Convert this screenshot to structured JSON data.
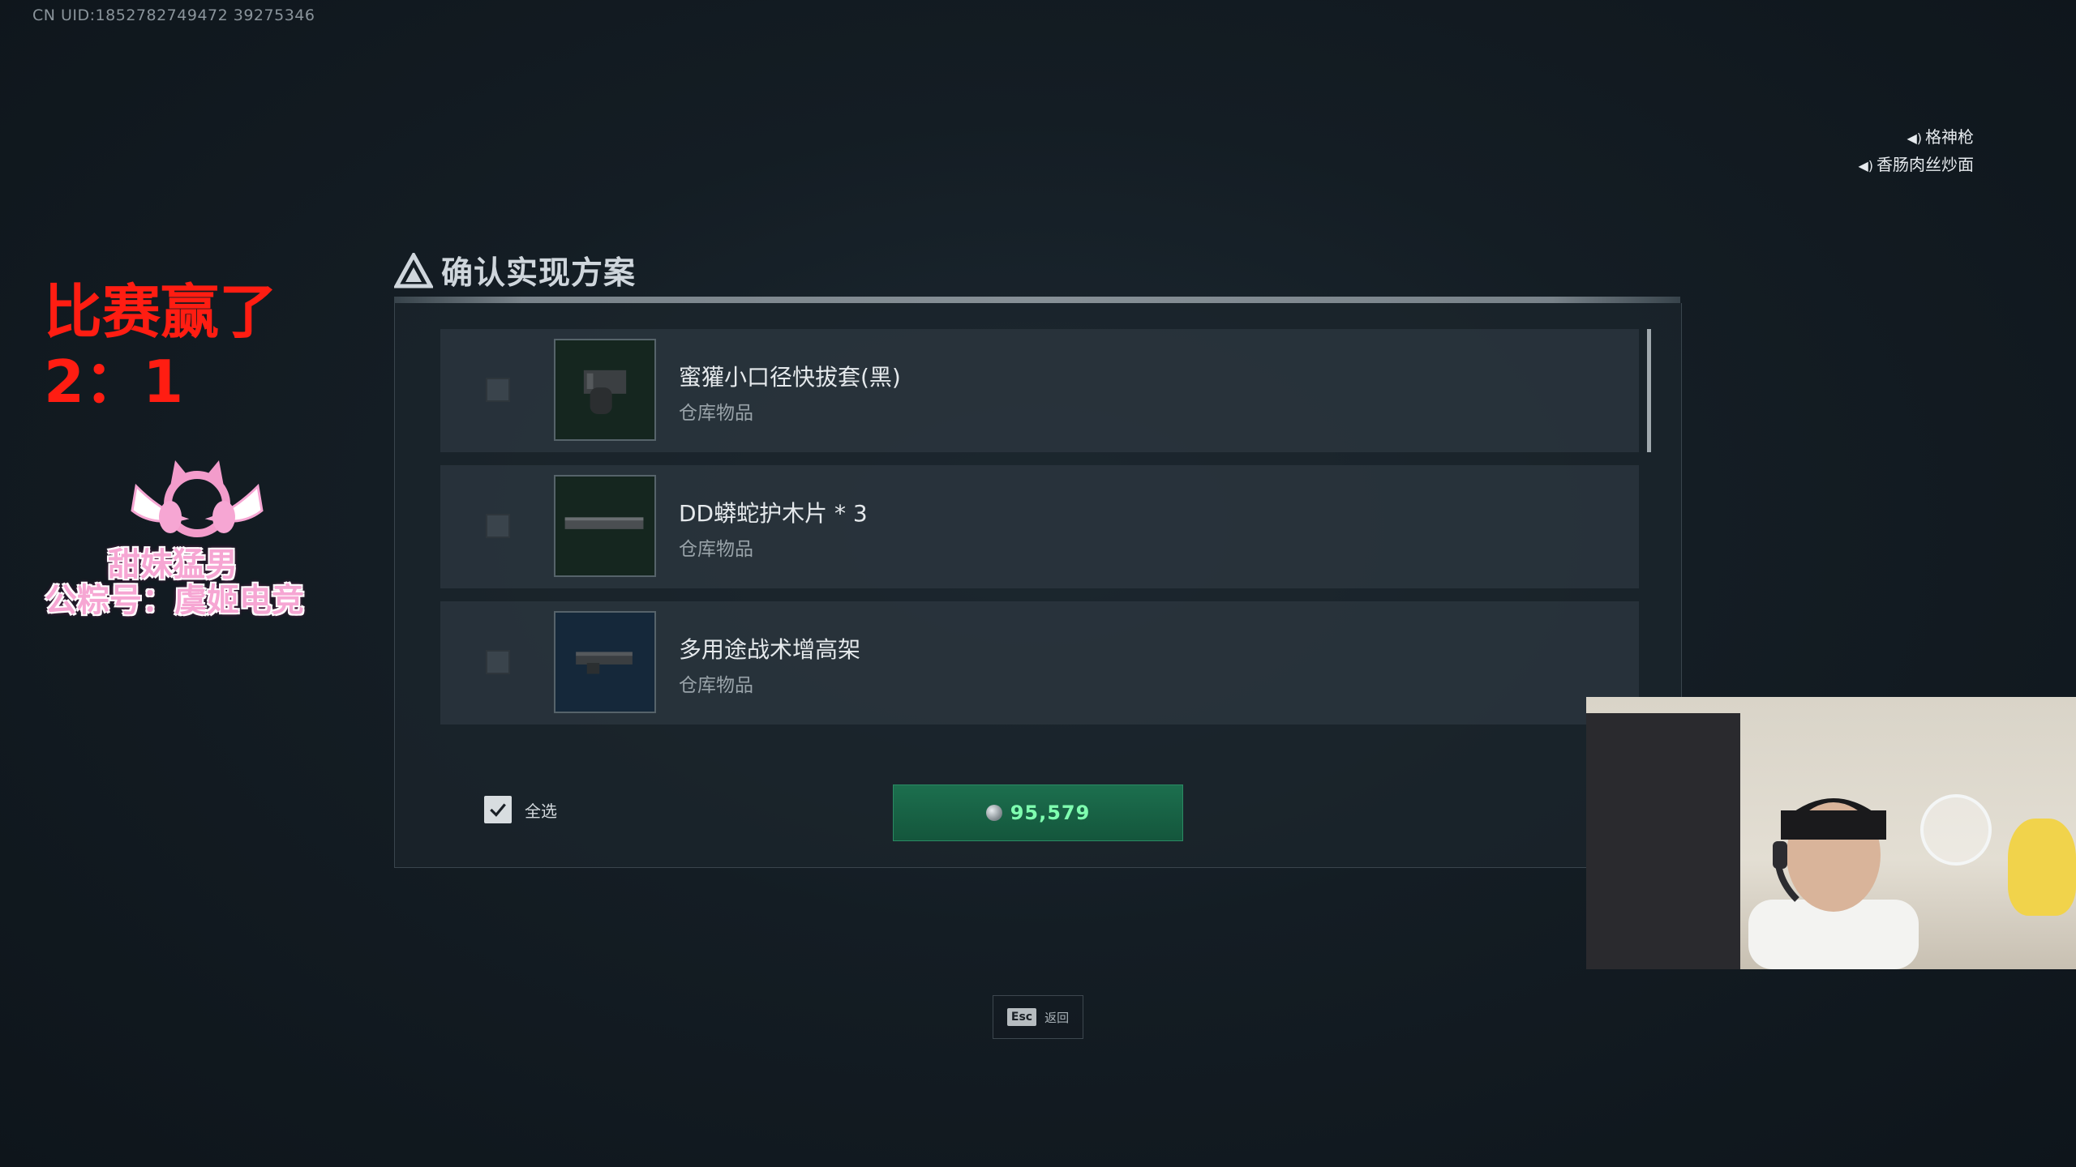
{
  "uid_text": "CN UID:1852782749472 39275346",
  "voice_lines": [
    {
      "icon": "speaker-icon",
      "label": "格神枪"
    },
    {
      "icon": "speaker-icon",
      "label": "香肠肉丝炒面"
    }
  ],
  "stream_overlay": {
    "line1": "比赛赢了",
    "line2": "2：1",
    "logo_line1": "甜妹猛男",
    "logo_line2": "公粽号：虞姬电竞"
  },
  "dialog": {
    "title": "确认实现方案",
    "items": [
      {
        "name": "蜜獾小口径快拔套(黑)",
        "sub": "仓库物品",
        "checked": false
      },
      {
        "name": "DD蟒蛇护木片 * 3",
        "sub": "仓库物品",
        "checked": false
      },
      {
        "name": "多用途战术增高架",
        "sub": "仓库物品",
        "checked": false
      }
    ],
    "select_all_label": "全选",
    "select_all_checked": true,
    "confirm_value": "95,579"
  },
  "esc_hint": {
    "key": "Esc",
    "label": "返回"
  },
  "colors": {
    "confirm_green": "#14563c",
    "value_text": "#7fffb0",
    "overlay_red": "#ff1d12"
  }
}
